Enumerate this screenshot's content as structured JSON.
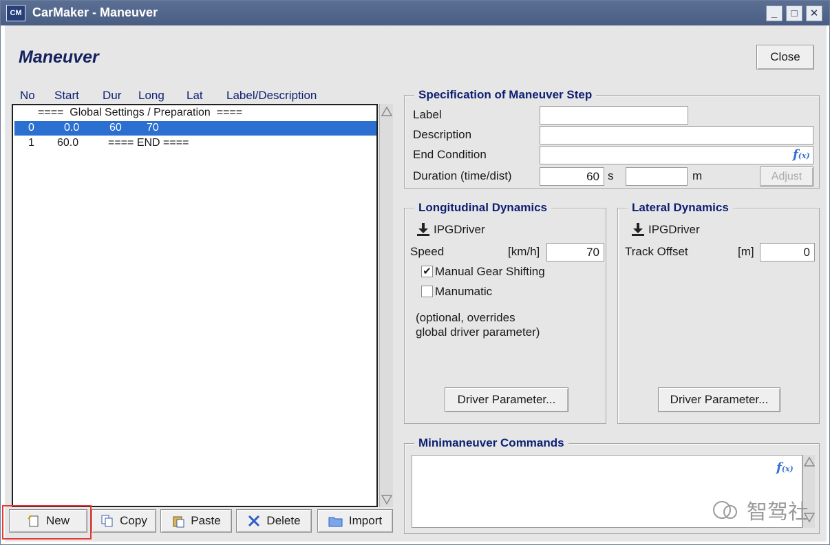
{
  "window": {
    "app_icon": "CM",
    "title": "CarMaker - Maneuver",
    "minimize": "_",
    "maximize": "□",
    "close": "✕"
  },
  "heading": "Maneuver",
  "close_button": "Close",
  "list": {
    "columns": [
      "No",
      "Start",
      "Dur",
      "Long",
      "Lat",
      "Label/Description"
    ],
    "rows": [
      {
        "text": "====  Global Settings / Preparation  ===="
      },
      {
        "no": "0",
        "start": "0.0",
        "dur": "60",
        "long": "70"
      },
      {
        "no": "1",
        "start": "60.0",
        "text": "==== END ===="
      }
    ]
  },
  "toolbar": {
    "new": "New",
    "copy": "Copy",
    "paste": "Paste",
    "delete": "Delete",
    "import": "Import"
  },
  "spec": {
    "title": "Specification of Maneuver Step",
    "label_label": "Label",
    "label_value": "",
    "description_label": "Description",
    "description_value": "",
    "end_condition_label": "End Condition",
    "end_condition_value": "",
    "fx": "f",
    "fx_sub": "(x)",
    "duration_label": "Duration (time/dist)",
    "duration_time": "60",
    "time_unit": "s",
    "duration_dist": "",
    "dist_unit": "m",
    "adjust": "Adjust"
  },
  "longitudinal": {
    "title": "Longitudinal Dynamics",
    "driver": "IPGDriver",
    "speed_label": "Speed",
    "speed_unit": "[km/h]",
    "speed_value": "70",
    "manual_gear": "Manual Gear Shifting",
    "manual_gear_checked": "✔",
    "manumatic": "Manumatic",
    "note_line1": "(optional, overrides",
    "note_line2": "global driver parameter)",
    "driver_param": "Driver Parameter..."
  },
  "lateral": {
    "title": "Lateral Dynamics",
    "driver": "IPGDriver",
    "offset_label": "Track Offset",
    "offset_unit": "[m]",
    "offset_value": "0",
    "driver_param": "Driver Parameter..."
  },
  "minimaneuver": {
    "title": "Minimaneuver Commands",
    "commands": ""
  },
  "watermark": "智驾社"
}
